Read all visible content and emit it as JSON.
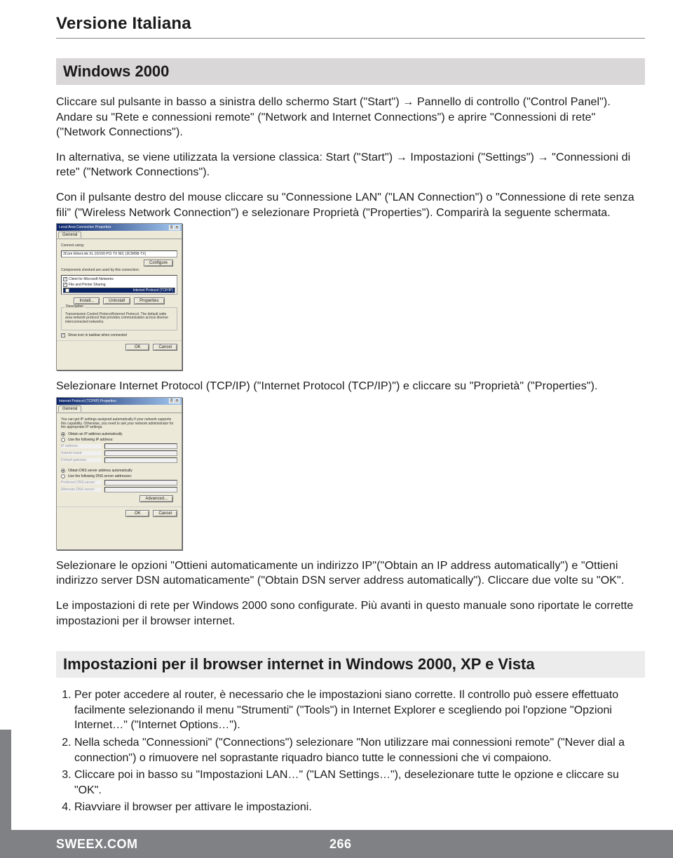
{
  "header": "Versione Italiana",
  "section1_title": "Windows 2000",
  "para1": "Cliccare sul pulsante in basso a sinistra dello schermo Start (\"Start\") → Pannello di controllo (\"Control Panel\"). Andare su \"Rete e connessioni remote\" (\"Network and Internet Connections\") e aprire \"Connessioni di rete\" (\"Network Connections\").",
  "para2": "In alternativa, se viene utilizzata la versione classica: Start (\"Start\") → Impostazioni (\"Settings\") → \"Connessioni di rete\" (\"Network Connections\").",
  "para3": "Con il pulsante destro del mouse cliccare su \"Connessione LAN\" (\"LAN Connection\") o \"Connessione di rete senza fili\" (\"Wireless Network Connection\") e selezionare Proprietà (\"Properties\"). Comparirà la seguente schermata.",
  "para4": "Selezionare Internet Protocol (TCP/IP) (\"Internet Protocol (TCP/IP)\") e cliccare su \"Proprietà\" (\"Properties\").",
  "para5": "Selezionare le opzioni \"Ottieni automaticamente un indirizzo IP\"(\"Obtain an IP address automatically\") e \"Ottieni indirizzo server DSN automaticamente\" (\"Obtain DSN server address automatically\"). Cliccare due volte su \"OK\".",
  "para6": "Le impostazioni di rete per Windows 2000 sono configurate. Più avanti in questo manuale sono riportate le corrette impostazioni per il browser internet.",
  "section2_title": "Impostazioni per il browser internet in Windows 2000, XP e Vista",
  "list2": [
    "Per poter accedere al router, è necessario che le impostazioni siano corrette. Il controllo può essere effettuato facilmente selezionando il menu \"Strumenti\" (\"Tools\") in Internet Explorer e scegliendo poi l'opzione \"Opzioni Internet…\" (\"Internet Options…\").",
    "Nella scheda \"Connessioni\" (\"Connections\") selezionare \"Non utilizzare mai connessioni remote\" (\"Never dial a connection\") o rimuovere nel soprastante riquadro bianco tutte le connessioni che vi compaiono.",
    "Cliccare poi in basso su \"Impostazioni LAN…\" (\"LAN Settings…\"), deselezionare tutte le opzione e cliccare su \"OK\".",
    "Riavviare il browser per attivare le impostazioni."
  ],
  "dialog1": {
    "title": "Local Area Connection Properties",
    "tab": "General",
    "connect_using_label": "Connect using:",
    "adapter": "3Com EtherLink XL 10/100 PCI TX NIC (3C905B-TX)",
    "configure": "Configure",
    "components_label": "Components checked are used by this connection:",
    "items": [
      {
        "checked": true,
        "label": "Client for Microsoft Networks",
        "selected": false
      },
      {
        "checked": true,
        "label": "File and Printer Sharing",
        "selected": false
      },
      {
        "checked": true,
        "label": "Internet Protocol (TCP/IP)",
        "selected": true
      }
    ],
    "install": "Install...",
    "uninstall": "Uninstall",
    "properties": "Properties",
    "desc_label": "Description",
    "desc": "Transmission Control Protocol/Internet Protocol. The default wide area network protocol that provides communication across diverse interconnected networks.",
    "showicon": "Show icon in taskbar when connected",
    "ok": "OK",
    "cancel": "Cancel"
  },
  "dialog2": {
    "title": "Internet Protocol (TCP/IP) Properties",
    "tab": "General",
    "intro": "You can get IP settings assigned automatically if your network supports this capability. Otherwise, you need to ask your network administrator for the appropriate IP settings.",
    "opt_auto_ip": "Obtain an IP address automatically",
    "opt_manual_ip": "Use the following IP address:",
    "ip": "IP address:",
    "subnet": "Subnet mask:",
    "gateway": "Default gateway:",
    "opt_auto_dns": "Obtain DNS server address automatically",
    "opt_manual_dns": "Use the following DNS server addresses:",
    "pref_dns": "Preferred DNS server:",
    "alt_dns": "Alternate DNS server:",
    "advanced": "Advanced...",
    "ok": "OK",
    "cancel": "Cancel"
  },
  "footer": {
    "brand": "SWEEX.COM",
    "page": "266"
  }
}
